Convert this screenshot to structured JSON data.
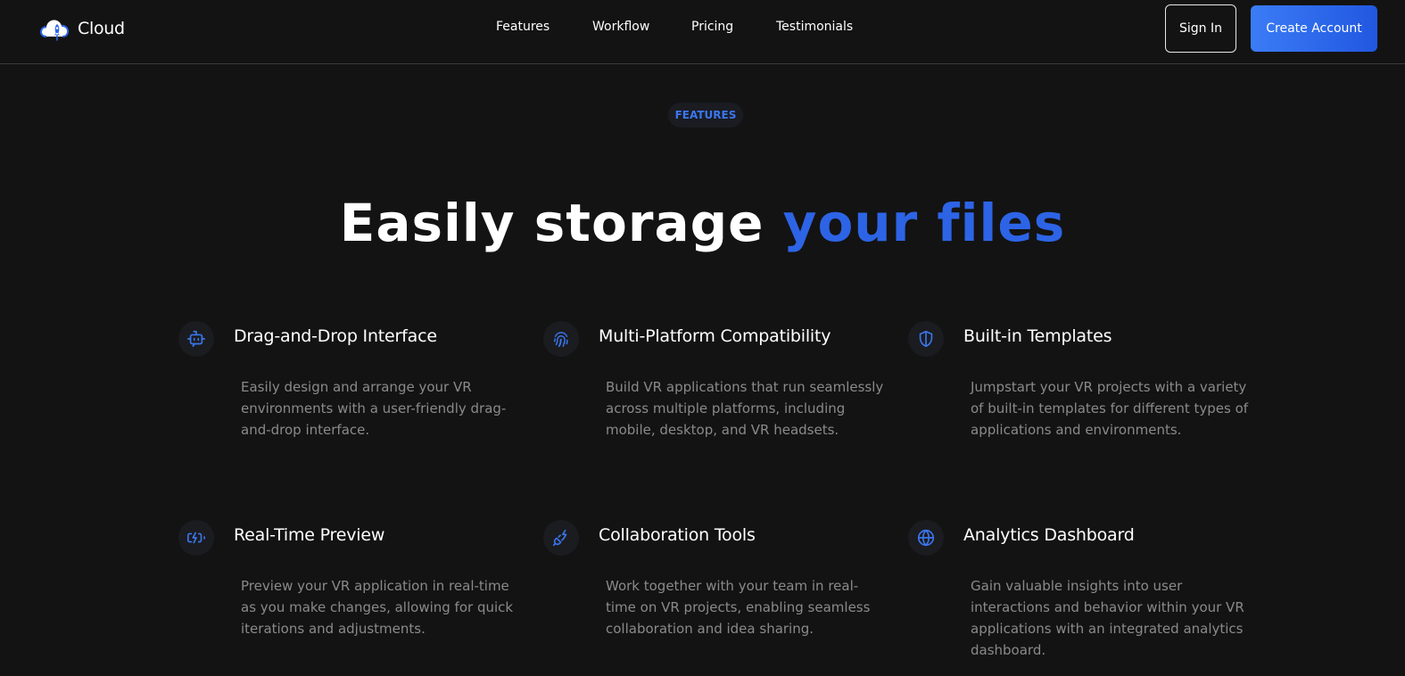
{
  "header": {
    "brand": {
      "name": "Cloud",
      "icon": "cloud-rocket-logo-icon"
    },
    "nav": [
      {
        "label": "Features"
      },
      {
        "label": "Workflow"
      },
      {
        "label": "Pricing"
      },
      {
        "label": "Testimonials"
      }
    ],
    "sign_in_label": "Sign In",
    "create_account_label": "Create Account"
  },
  "section": {
    "eyebrow": "FEATURES",
    "headline_part1": "Easily storage ",
    "headline_accent": "your files"
  },
  "features": [
    {
      "title": "Drag-and-Drop Interface",
      "description": "Easily design and arrange your VR environments with a user-friendly drag-and-drop interface.",
      "icon": "bot-icon"
    },
    {
      "title": "Multi-Platform Compatibility",
      "description": "Build VR applications that run seamlessly across multiple platforms, including mobile, desktop, and VR headsets.",
      "icon": "fingerprint-icon"
    },
    {
      "title": "Built-in Templates",
      "description": "Jumpstart your VR projects with a variety of built-in templates for different types of applications and environments.",
      "icon": "shield-icon"
    },
    {
      "title": "Real-Time Preview",
      "description": "Preview your VR application in real-time as you make changes, allowing for quick iterations and adjustments.",
      "icon": "battery-charging-icon"
    },
    {
      "title": "Collaboration Tools",
      "description": "Work together with your team in real-time on VR projects, enabling seamless collaboration and idea sharing.",
      "icon": "plug-zap-icon"
    },
    {
      "title": "Analytics Dashboard",
      "description": "Gain valuable insights into user interactions and behavior within your VR applications with an integrated analytics dashboard.",
      "icon": "globe-icon"
    }
  ],
  "colors": {
    "background": "#131313",
    "accent": "#2d64e6",
    "button_gradient_start": "#3b7cf6",
    "button_gradient_end": "#2157e0",
    "body_text": "#8a8a8a"
  }
}
